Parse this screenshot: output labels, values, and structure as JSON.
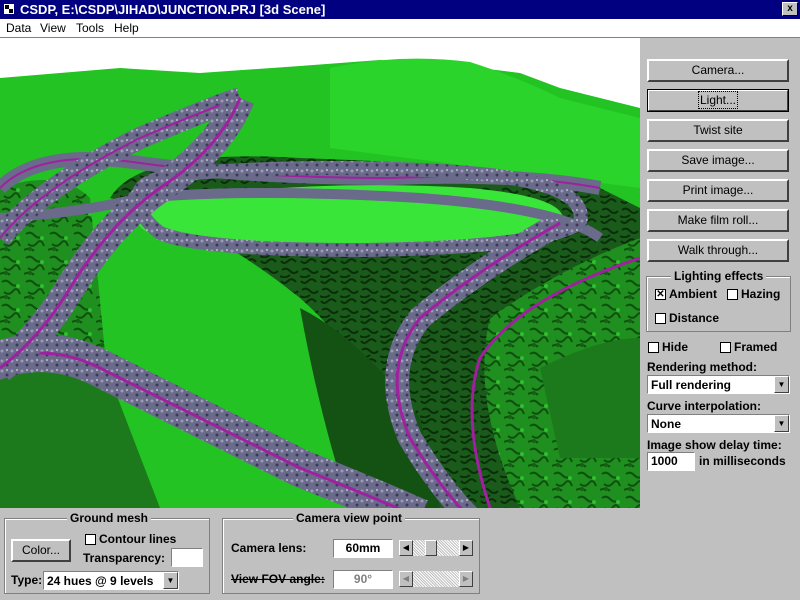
{
  "window": {
    "title": "CSDP, E:\\CSDP\\JIHAD\\JUNCTION.PRJ [3d Scene]",
    "close_glyph": "x"
  },
  "menu": [
    {
      "label": "Data",
      "u": "D"
    },
    {
      "label": "View",
      "u": "V"
    },
    {
      "label": "Tools",
      "u": "T"
    },
    {
      "label": "Help",
      "u": "H"
    }
  ],
  "buttons": {
    "camera": "Camera...",
    "light": "Light...",
    "twist": "Twist site",
    "save": "Save image...",
    "print": "Print image...",
    "film": "Make film roll...",
    "walk": "Walk through..."
  },
  "lighting": {
    "title": "Lighting effects",
    "ambient": {
      "label": "Ambient",
      "checked": true
    },
    "hazing": {
      "label": "Hazing",
      "checked": false
    },
    "distance": {
      "label": "Distance",
      "checked": false
    }
  },
  "hide": {
    "label": "Hide",
    "checked": false
  },
  "framed": {
    "label": "Framed",
    "checked": false
  },
  "rendering": {
    "label": "Rendering method:",
    "value": "Full rendering"
  },
  "curve": {
    "label": "Curve interpolation:",
    "value": "None"
  },
  "delay": {
    "label": "Image show delay time:",
    "value": "1000",
    "unit": "in milliseconds"
  },
  "ground_mesh": {
    "title": "Ground mesh",
    "color_button": "Color...",
    "contour": {
      "label": "Contour lines",
      "checked": false
    },
    "transparency_label": "Transparency:",
    "transparency_value": "",
    "type_label": "Type:",
    "type_value": "24 hues @ 9 levels"
  },
  "camera_view": {
    "title": "Camera view point",
    "lens_label": "Camera lens:",
    "lens_value": "60mm",
    "lens_position": 0.35,
    "fov_label": "View FOV angle:",
    "fov_value": "90°",
    "fov_position": 0.0
  },
  "colors": {
    "title_bar": "#000080",
    "terrain_bright": "#22dd22",
    "terrain_dark": "#1a6b1a",
    "road": "#6a6a8a",
    "centerline": "#a020a0"
  }
}
